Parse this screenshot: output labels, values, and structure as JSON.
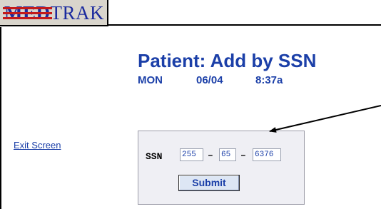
{
  "app": {
    "logo_prefix": "MED",
    "logo_suffix": "TRAK"
  },
  "page": {
    "title": "Patient: Add by SSN",
    "day": "MON",
    "date": "06/04",
    "time": "8:37a"
  },
  "nav": {
    "exit_label": "Exit Screen"
  },
  "ssn_form": {
    "label": "SSN",
    "part1": "255",
    "part2": "65",
    "part3": "6376",
    "separator": "–",
    "submit_label": "Submit"
  },
  "colors": {
    "accent_blue": "#1b3fa8",
    "logo_background": "#d9d5cc",
    "panel_background": "#efeff4",
    "button_background": "#dde6f4"
  }
}
